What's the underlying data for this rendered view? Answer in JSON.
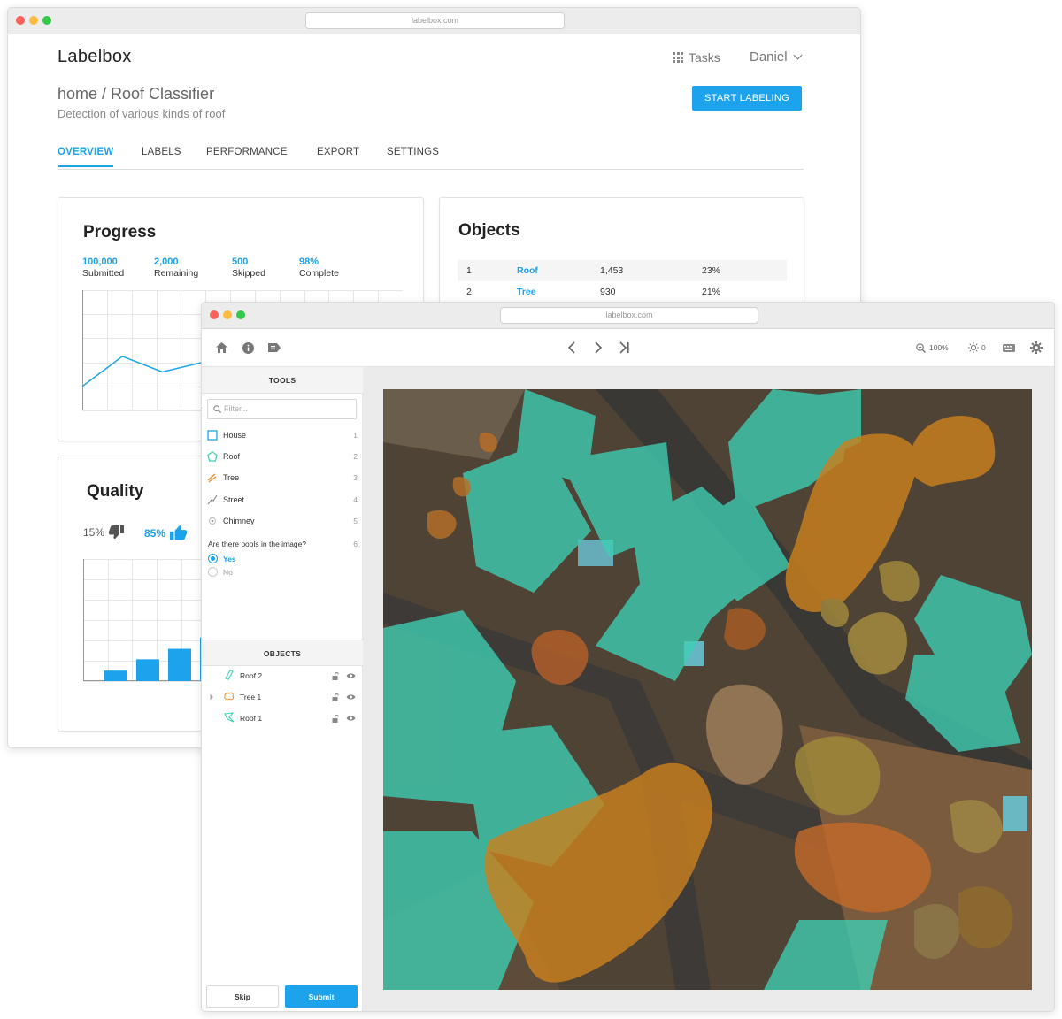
{
  "back_window": {
    "url": "labelbox.com",
    "logo": "Labelbox",
    "tasks_label": "Tasks",
    "user_name": "Daniel",
    "breadcrumb": "home / Roof Classifier",
    "subtitle": "Detection of various kinds of roof",
    "start_button": "START LABELING",
    "tabs": [
      "OVERVIEW",
      "LABELS",
      "PERFORMANCE",
      "EXPORT",
      "SETTINGS"
    ],
    "active_tab": "OVERVIEW",
    "progress": {
      "title": "Progress",
      "stats": [
        {
          "value": "100,000",
          "label": "Submitted"
        },
        {
          "value": "2,000",
          "label": "Remaining"
        },
        {
          "value": "500",
          "label": "Skipped"
        },
        {
          "value": "98%",
          "label": "Complete"
        }
      ]
    },
    "objects": {
      "title": "Objects",
      "rows": [
        {
          "rank": "1",
          "name": "Roof",
          "count": "1,453",
          "pct": "23%"
        },
        {
          "rank": "2",
          "name": "Tree",
          "count": "930",
          "pct": "21%"
        }
      ]
    },
    "quality": {
      "title": "Quality",
      "down_pct": "15%",
      "up_pct": "85%"
    }
  },
  "front_window": {
    "url": "labelbox.com",
    "zoom": "100%",
    "brightness": "0",
    "tools_header": "TOOLS",
    "filter_placeholder": "Filter...",
    "tools": [
      {
        "label": "House",
        "key": "1",
        "icon": "square-icon",
        "color": "#1ca3ec"
      },
      {
        "label": "Roof",
        "key": "2",
        "icon": "polygon-icon",
        "color": "#3ecfb4"
      },
      {
        "label": "Tree",
        "key": "3",
        "icon": "brush-icon",
        "color": "#e8902e"
      },
      {
        "label": "Street",
        "key": "4",
        "icon": "line-icon",
        "color": "#888888"
      },
      {
        "label": "Chimney",
        "key": "5",
        "icon": "point-icon",
        "color": "#aaaaaa"
      }
    ],
    "question": {
      "text": "Are there pools in the image?",
      "key": "6",
      "options": [
        "Yes",
        "No"
      ],
      "selected": "Yes"
    },
    "objects_header": "OBJECTS",
    "objects": [
      {
        "label": "Roof 2",
        "icon": "polygon-icon"
      },
      {
        "label": "Tree 1",
        "icon": "brush-icon"
      },
      {
        "label": "Roof 1",
        "icon": "polygon-icon"
      }
    ],
    "skip_label": "Skip",
    "submit_label": "Submit"
  },
  "colors": {
    "accent": "#1ca3ec",
    "roof_overlay": "#3ecfb4",
    "tree_overlay": "#c9801e"
  },
  "chart_data": [
    {
      "type": "line",
      "x": [
        0,
        1,
        2,
        3
      ],
      "series": [
        {
          "values": [
            20,
            45,
            32,
            40
          ]
        }
      ],
      "grid": true
    },
    {
      "type": "bar",
      "categories": [
        "1",
        "2",
        "3",
        "4"
      ],
      "values": [
        12,
        25,
        37,
        50
      ],
      "grid": true
    }
  ]
}
